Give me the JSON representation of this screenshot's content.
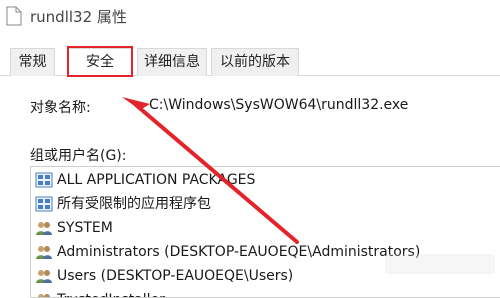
{
  "window": {
    "title": "rundll32 属性"
  },
  "tabs": [
    {
      "label": "常规"
    },
    {
      "label": "安全"
    },
    {
      "label": "详细信息"
    },
    {
      "label": "以前的版本"
    }
  ],
  "object": {
    "label": "对象名称:",
    "value": "C:\\Windows\\SysWOW64\\rundll32.exe"
  },
  "group": {
    "label": "组或用户名(G):"
  },
  "users": [
    {
      "name": "ALL APPLICATION PACKAGES",
      "icon": "app-packages-icon"
    },
    {
      "name": "所有受限制的应用程序包",
      "icon": "app-packages-icon"
    },
    {
      "name": "SYSTEM",
      "icon": "users-icon"
    },
    {
      "name": "Administrators (DESKTOP-EAUOEQE\\Administrators)",
      "icon": "users-icon"
    },
    {
      "name": "Users (DESKTOP-EAUOEQE\\Users)",
      "icon": "users-icon"
    },
    {
      "name": "TrustedInstaller",
      "icon": "users-icon"
    }
  ],
  "colors": {
    "highlight": "#e3252b",
    "border": "#d9d9d9"
  }
}
